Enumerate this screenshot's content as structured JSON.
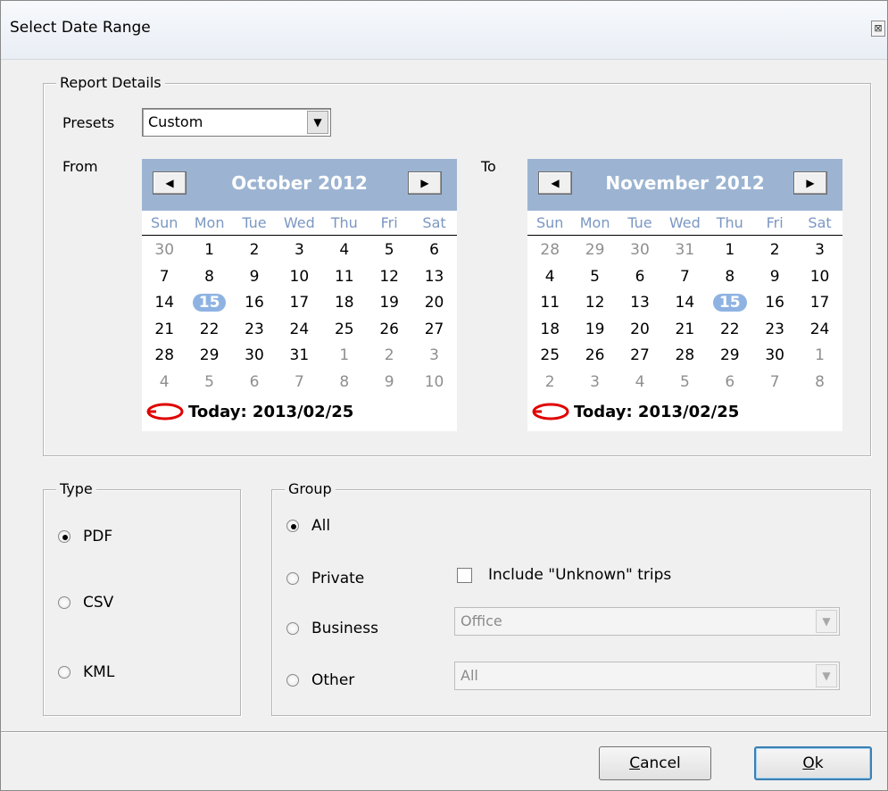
{
  "window": {
    "title": "Select Date Range",
    "close_glyph": "⊠"
  },
  "report_details": {
    "legend": "Report Details",
    "presets_label": "Presets",
    "presets_value": "Custom",
    "from_label": "From",
    "to_label": "To"
  },
  "day_names": [
    "Sun",
    "Mon",
    "Tue",
    "Wed",
    "Thu",
    "Fri",
    "Sat"
  ],
  "calendars": {
    "from": {
      "month": "October 2012",
      "today": "Today: 2013/02/25",
      "days": [
        [
          "30",
          "1",
          "2",
          "3",
          "4",
          "5",
          "6"
        ],
        [
          "7",
          "8",
          "9",
          "10",
          "11",
          "12",
          "13"
        ],
        [
          "14",
          "15",
          "16",
          "17",
          "18",
          "19",
          "20"
        ],
        [
          "21",
          "22",
          "23",
          "24",
          "25",
          "26",
          "27"
        ],
        [
          "28",
          "29",
          "30",
          "31",
          "1",
          "2",
          "3"
        ],
        [
          "4",
          "5",
          "6",
          "7",
          "8",
          "9",
          "10"
        ]
      ],
      "other_month": [
        [
          0
        ],
        [],
        [],
        [],
        [
          4,
          5,
          6
        ],
        [
          0,
          1,
          2,
          3,
          4,
          5,
          6
        ]
      ],
      "selected": [
        2,
        1
      ]
    },
    "to": {
      "month": "November 2012",
      "today": "Today: 2013/02/25",
      "days": [
        [
          "28",
          "29",
          "30",
          "31",
          "1",
          "2",
          "3"
        ],
        [
          "4",
          "5",
          "6",
          "7",
          "8",
          "9",
          "10"
        ],
        [
          "11",
          "12",
          "13",
          "14",
          "15",
          "16",
          "17"
        ],
        [
          "18",
          "19",
          "20",
          "21",
          "22",
          "23",
          "24"
        ],
        [
          "25",
          "26",
          "27",
          "28",
          "29",
          "30",
          "1"
        ],
        [
          "2",
          "3",
          "4",
          "5",
          "6",
          "7",
          "8"
        ]
      ],
      "other_month": [
        [
          0,
          1,
          2,
          3
        ],
        [],
        [],
        [],
        [
          6
        ],
        [
          0,
          1,
          2,
          3,
          4,
          5,
          6
        ]
      ],
      "selected": [
        2,
        4
      ]
    }
  },
  "type": {
    "legend": "Type",
    "options": [
      "PDF",
      "CSV",
      "KML"
    ],
    "selected": "PDF"
  },
  "group": {
    "legend": "Group",
    "options": [
      "All",
      "Private",
      "Business",
      "Other"
    ],
    "selected": "All",
    "include_unknown_label": "Include \"Unknown\" trips",
    "include_unknown_checked": false,
    "business_value": "Office",
    "other_value": "All"
  },
  "buttons": {
    "cancel_prefix": "",
    "cancel_mnemonic": "C",
    "cancel_rest": "ancel",
    "ok_mnemonic": "O",
    "ok_rest": "k"
  },
  "icons": {
    "prev": "prev-month-icon",
    "next": "next-month-icon",
    "dropdown": "chevron-down-icon",
    "today": "today-circle-icon"
  },
  "colors": {
    "calendar_header": "#9cb4d2",
    "day_name": "#7b97c2",
    "selected_day": "#8eb3e2",
    "today_marker": "#e00000",
    "default_button_border": "#3c7fb1"
  }
}
